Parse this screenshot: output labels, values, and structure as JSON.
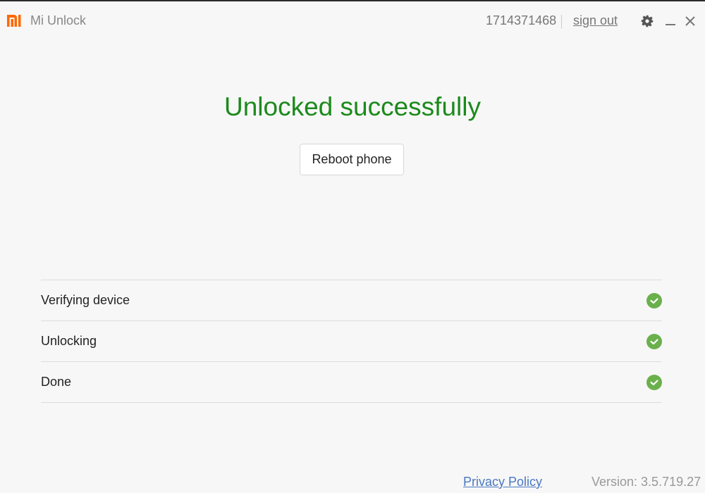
{
  "titlebar": {
    "app_title": "Mi Unlock",
    "account_id": "1714371468",
    "sign_out_label": "sign out",
    "logo_icon": "mi-logo-icon",
    "settings_icon": "gear-icon",
    "minimize_icon": "minimize-icon",
    "close_icon": "close-icon",
    "brand_color": "#ff6900"
  },
  "main": {
    "status_title": "Unlocked successfully",
    "status_color": "#1b8a1b",
    "reboot_button_label": "Reboot phone"
  },
  "steps": [
    {
      "label": "Verifying device",
      "status": "complete",
      "icon": "check-circle-icon"
    },
    {
      "label": "Unlocking",
      "status": "complete",
      "icon": "check-circle-icon"
    },
    {
      "label": "Done",
      "status": "complete",
      "icon": "check-circle-icon"
    }
  ],
  "check_color": "#6ab04c",
  "footer": {
    "privacy_policy_label": "Privacy Policy",
    "version_label": "Version: 3.5.719.27"
  }
}
